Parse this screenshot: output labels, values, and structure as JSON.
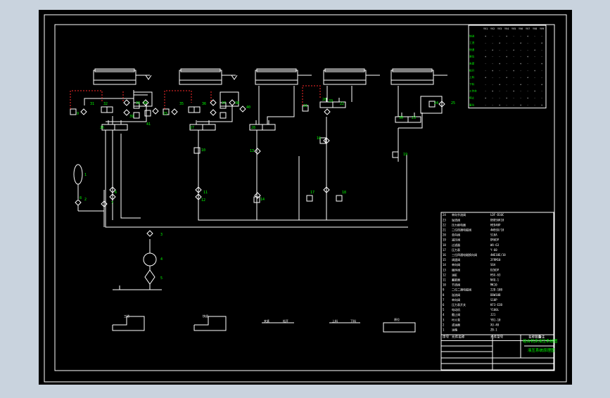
{
  "viewport": {
    "background": "#c9d3de",
    "sheet": "#000000"
  },
  "colors": {
    "line": "#ffffff",
    "label": "#00ff00",
    "dashed": "#ff2a2a",
    "title_fill": "#00ff00"
  },
  "sequence_table": {
    "columns": [
      "YV1",
      "YV2",
      "YV3",
      "YV4",
      "YV5",
      "YV6",
      "YV7",
      "YV8",
      "YV9"
    ],
    "rows": [
      "快进",
      "工进",
      "快退",
      "原位",
      "夹紧",
      "松开",
      "上料",
      "下料",
      "工作台",
      "停止",
      "复位"
    ]
  },
  "parts_list": {
    "rows": [
      {
        "no": "24",
        "name": "单向节流阀",
        "model": "LDF-B10C"
      },
      {
        "no": "23",
        "name": "溢流阀",
        "model": "DBDS6K10"
      },
      {
        "no": "22",
        "name": "压力继电器",
        "model": "HED40P"
      },
      {
        "no": "21",
        "name": "二位四通电磁阀",
        "model": "4WE6D/10"
      },
      {
        "no": "20",
        "name": "单向阀",
        "model": "S10A"
      },
      {
        "no": "19",
        "name": "减压阀",
        "model": "DR6DP"
      },
      {
        "no": "18",
        "name": "过滤器",
        "model": "WU-63"
      },
      {
        "no": "17",
        "name": "压力表",
        "model": "Y-60"
      },
      {
        "no": "16",
        "name": "三位四通电磁换向阀",
        "model": "4WE10E/10"
      },
      {
        "no": "15",
        "name": "调速阀",
        "model": "2FRM10"
      },
      {
        "no": "14",
        "name": "单向阀",
        "model": "S6A"
      },
      {
        "no": "13",
        "name": "顺序阀",
        "model": "DZ6DP"
      },
      {
        "no": "12",
        "name": "油缸",
        "model": "HSG-63"
      },
      {
        "no": "11",
        "name": "蓄能器",
        "model": "NXQ-1"
      },
      {
        "no": "10",
        "name": "节流阀",
        "model": "MK10"
      },
      {
        "no": "9",
        "name": "二位二通电磁阀",
        "model": "22D-10B"
      },
      {
        "no": "8",
        "name": "溢流阀",
        "model": "DBW10B"
      },
      {
        "no": "7",
        "name": "单向阀",
        "model": "S10P"
      },
      {
        "no": "6",
        "name": "压力表开关",
        "model": "KF3-E3B"
      },
      {
        "no": "5",
        "name": "电动机",
        "model": "Y100L"
      },
      {
        "no": "4",
        "name": "截止阀",
        "model": "J21"
      },
      {
        "no": "3",
        "name": "叶片泵",
        "model": "YB1-10"
      },
      {
        "no": "2",
        "name": "滤油器",
        "model": "XU-40"
      },
      {
        "no": "1",
        "name": "油箱",
        "model": "ZB-1"
      }
    ],
    "footer": [
      "序号",
      "元件名称",
      "元件型号",
      "名称数量",
      "备注"
    ]
  },
  "title_block": {
    "line1": "组合机床液压系统图",
    "line2": "液压系统原理图"
  },
  "component_labels": [
    "1",
    "2",
    "3",
    "4",
    "5",
    "6",
    "7",
    "8",
    "9",
    "10",
    "11",
    "12",
    "13",
    "14",
    "15",
    "16",
    "17",
    "18",
    "19",
    "20",
    "21",
    "22",
    "23",
    "24",
    "25",
    "26",
    "27",
    "28",
    "29",
    "30",
    "31",
    "32",
    "33",
    "34",
    "35",
    "36",
    "37",
    "38",
    "39",
    "40",
    "41",
    "YV1",
    "YV2",
    "YV3",
    "YV4",
    "YV5",
    "YV6",
    "YV7",
    "YV8",
    "YV9"
  ],
  "cycle_diagram_labels": [
    "工进",
    "快退",
    "夹紧",
    "松开",
    "上料",
    "下料",
    "原位"
  ]
}
